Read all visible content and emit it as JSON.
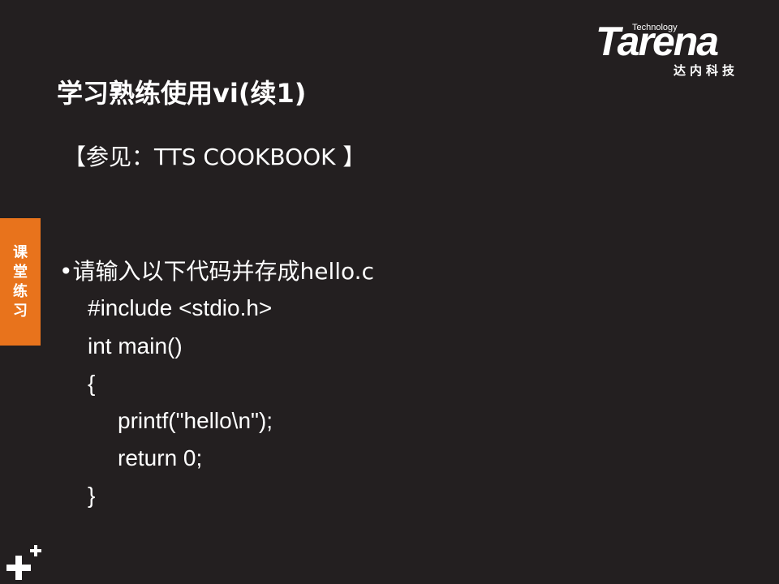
{
  "logo": {
    "technology": "Technology",
    "wordmark": "Tarena",
    "chinese": "达内科技"
  },
  "slide": {
    "title": "学习熟练使用vi(续1)",
    "reference": "【参见：TTS COOKBOOK 】",
    "side_tab": [
      "课",
      "堂",
      "练",
      "习"
    ],
    "bullet": "•请输入以下代码并存成hello.c",
    "code": [
      "#include <stdio.h>",
      "int main()",
      "{",
      "printf(\"hello\\n\");",
      "return 0;",
      "}"
    ]
  },
  "colors": {
    "background": "#231f20",
    "accent": "#e8731c",
    "text": "#ffffff"
  },
  "icons": {
    "decoration": "plus-icon"
  }
}
